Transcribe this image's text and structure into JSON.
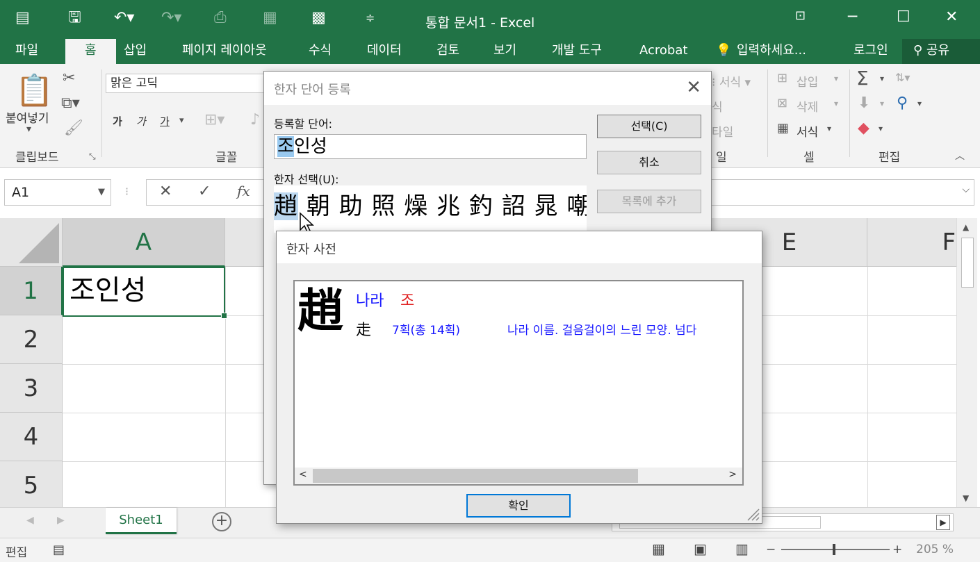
{
  "window": {
    "title": "통합 문서1 - Excel"
  },
  "tabs": {
    "file": "파일",
    "home": "홈",
    "insert": "삽입",
    "page_layout": "페이지 레이아웃",
    "formulas": "수식",
    "data": "데이터",
    "review": "검토",
    "view": "보기",
    "developer": "개발 도구",
    "acrobat": "Acrobat",
    "tell_me": "입력하세요...",
    "sign_in": "로그인",
    "share": "공유"
  },
  "ribbon": {
    "paste": "붙여넣기",
    "clipboard": "클립보드",
    "font_name": "맑은 고딕",
    "bold": "가",
    "italic": "가",
    "underline": "가",
    "font_group": "글꼴",
    "conditional_format": "서식",
    "insert": "삽입",
    "delete": "삭제",
    "format": "서식",
    "cells_group": "셀",
    "edit_group": "편집",
    "style_partial_1": "식",
    "style_partial_2": "타일",
    "style_partial_3": "일"
  },
  "formula_bar": {
    "name_box": "A1",
    "fx": "fx"
  },
  "grid": {
    "columns": [
      "A",
      "E",
      "F"
    ],
    "rows": [
      "1",
      "2",
      "3",
      "4",
      "5"
    ],
    "a1_value": "조인성"
  },
  "sheets": {
    "active": "Sheet1"
  },
  "status": {
    "mode": "편집",
    "zoom": "205 %"
  },
  "dialog_register": {
    "title": "한자 단어 등록",
    "word_label": "등록할 단어:",
    "word_highlight": "조",
    "word_rest": "인성",
    "hanja_label": "한자 선택(U):",
    "hanja_row1": [
      "趙",
      "朝",
      "助",
      "照",
      "燥",
      "兆",
      "釣",
      "詔",
      "晁",
      "嘲"
    ],
    "btn_select": "선택(C)",
    "btn_cancel": "취소",
    "btn_add": "목록에 추가"
  },
  "dialog_dict": {
    "title": "한자 사전",
    "char": "趙",
    "meaning": "나라",
    "sound": "조",
    "radical": "走",
    "strokes": "7획(총 14획)",
    "description": "나라 이름. 걸음걸이의 느린 모양. 넘다",
    "ok": "확인"
  },
  "colors": {
    "excel_green": "#217346",
    "selection_blue": "#99c9ef",
    "dict_blue": "#1a1aff",
    "dict_red": "#e02020"
  }
}
